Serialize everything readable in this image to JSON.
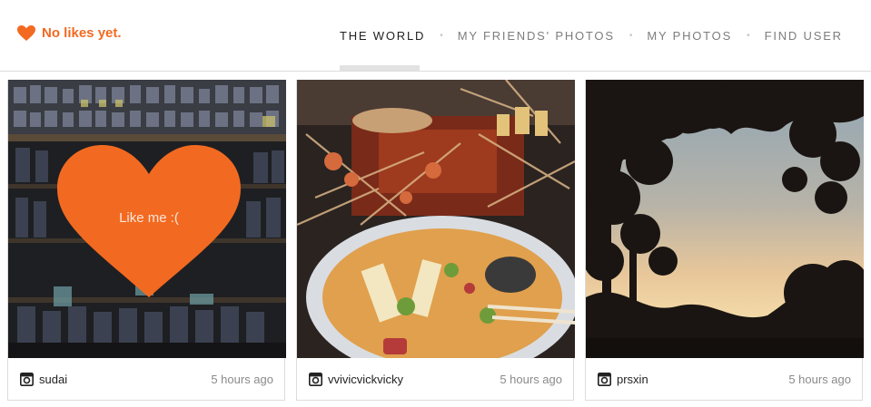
{
  "colors": {
    "accent": "#f26a21",
    "text": "#222222",
    "muted": "#8a8a8a",
    "border": "#dcdcdc"
  },
  "header": {
    "status_icon": "heart-icon",
    "status_text": "No likes yet.",
    "nav": [
      {
        "label": "THE WORLD",
        "active": true
      },
      {
        "label": "MY FRIENDS' PHOTOS",
        "active": false
      },
      {
        "label": "MY PHOTOS",
        "active": false
      },
      {
        "label": "FIND USER",
        "active": false
      }
    ]
  },
  "cards": [
    {
      "photo": "candle-shop-shelves",
      "username": "sudai",
      "time": "5 hours ago",
      "like_prompt": "Like me :(",
      "user_icon": "instagram-icon"
    },
    {
      "photo": "grilled-skewers-and-noodle-soup",
      "username": "vvivicvickvicky",
      "time": "5 hours ago",
      "user_icon": "instagram-icon"
    },
    {
      "photo": "sunset-tree-silhouette",
      "username": "prsxin",
      "time": "5 hours ago",
      "user_icon": "instagram-icon"
    }
  ]
}
